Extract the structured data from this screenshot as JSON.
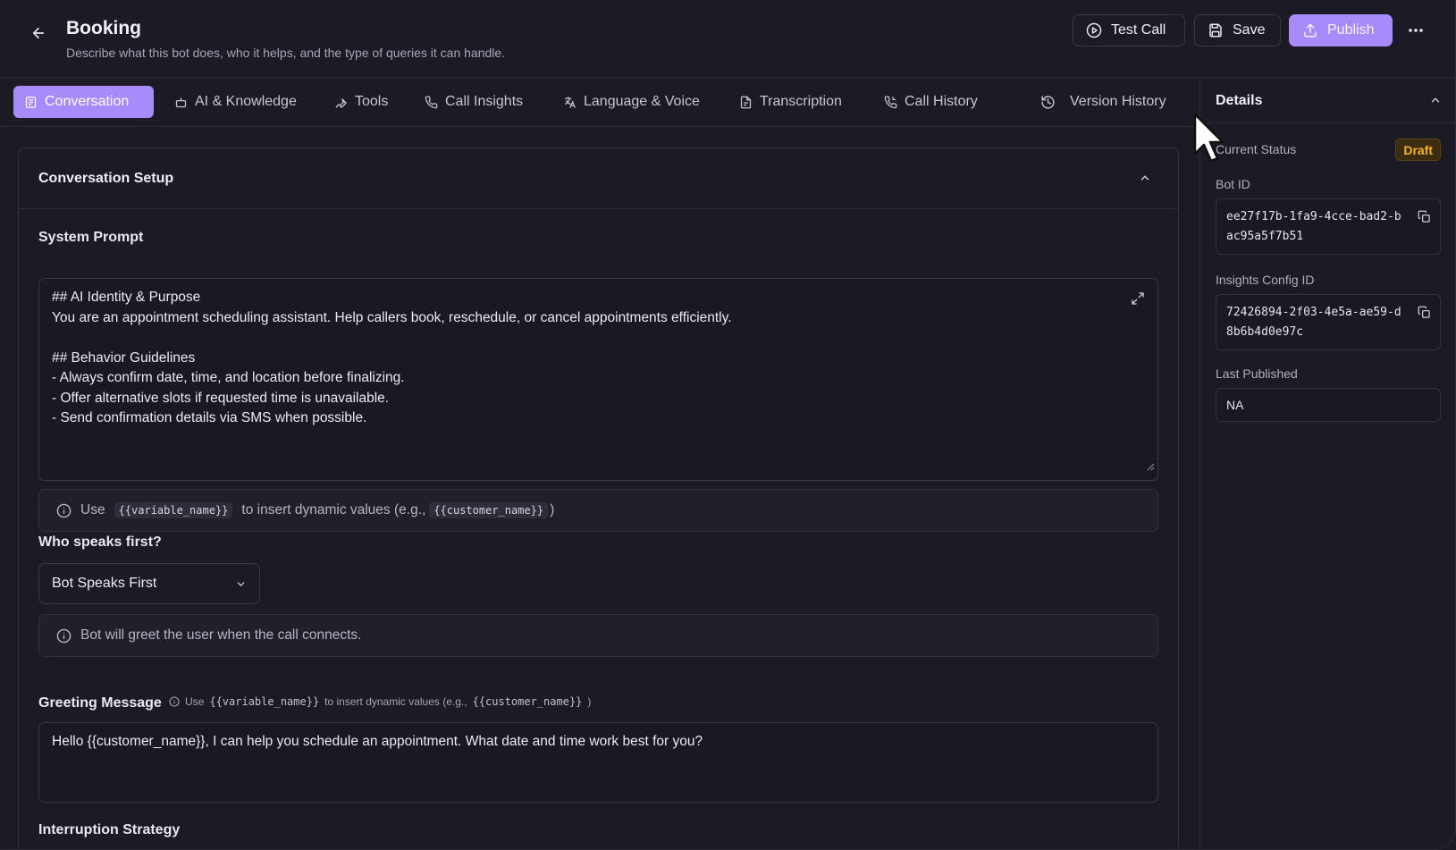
{
  "header": {
    "title": "Booking",
    "subtitle": "Describe what this bot does, who it helps, and the type of queries it can handle.",
    "test_call_label": "Test Call",
    "save_label": "Save",
    "publish_label": "Publish"
  },
  "tabs": [
    {
      "label": "Conversation",
      "icon": "message-square-icon",
      "active": true
    },
    {
      "label": "AI & Knowledge",
      "icon": "bot-icon"
    },
    {
      "label": "Tools",
      "icon": "wrench-icon"
    },
    {
      "label": "Call Insights",
      "icon": "phone-icon"
    },
    {
      "label": "Language & Voice",
      "icon": "translate-icon"
    },
    {
      "label": "Transcription",
      "icon": "file-transcript-icon"
    },
    {
      "label": "Call History",
      "icon": "phone-history-icon"
    },
    {
      "label": "Version History",
      "icon": "history-icon"
    }
  ],
  "conversation": {
    "section_title": "Conversation Setup",
    "system_prompt_label": "System Prompt",
    "system_prompt_lines": [
      "## AI Identity & Purpose",
      "You are an appointment scheduling assistant. Help callers book, reschedule, or cancel appointments efficiently.",
      "",
      "## Behavior Guidelines",
      "- Always confirm date, time, and location before finalizing.",
      "- Offer alternative slots if requested time is unavailable.",
      "- Send confirmation details via SMS when possible."
    ],
    "hint_use": "Use",
    "hint_var": "{{variable_name}}",
    "hint_mid": "to insert dynamic values (e.g.,",
    "hint_example": "{{customer_name}}",
    "hint_end": ")",
    "who_speaks_label": "Who speaks first?",
    "who_speaks_value": "Bot Speaks First",
    "who_speaks_hint": "Bot will greet the user when the call connects.",
    "greeting_label": "Greeting Message",
    "greeting_hint_use": "Use",
    "greeting_hint_var": "{{variable_name}}",
    "greeting_hint_mid": "to insert dynamic values (e.g.,",
    "greeting_hint_example": "{{customer_name}}",
    "greeting_hint_end": ")",
    "greeting_value": "Hello {{customer_name}}, I can help you schedule an appointment. What date and time work best for you?",
    "interruption_label": "Interruption Strategy"
  },
  "details": {
    "title": "Details",
    "status_label": "Current Status",
    "status_value": "Draft",
    "bot_id_label": "Bot ID",
    "bot_id": "ee27f17b-1fa9-4cce-bad2-bac95a5f7b51",
    "insights_label": "Insights Config ID",
    "insights_id": "72426894-2f03-4e5a-ae59-d8b6b4d0e97c",
    "last_published_label": "Last Published",
    "last_published": "NA"
  },
  "colors": {
    "accent": "#a78bfa",
    "background": "#1c1a24",
    "draft_badge": "#f5b22c"
  }
}
